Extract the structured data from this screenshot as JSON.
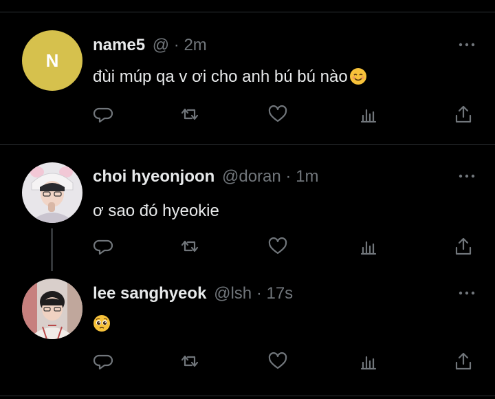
{
  "tweets": [
    {
      "avatar_letter": "N",
      "name": "name5",
      "handle": "@",
      "separator": "·",
      "time": "2m",
      "text": "đùi múp qa v ơi cho anh bú bú nào",
      "text_emoji": "smiling-face-icon"
    },
    {
      "name": "choi hyeonjoon",
      "handle": "@doran",
      "separator": "·",
      "time": "1m",
      "text": "ơ sao đó hyeokie"
    },
    {
      "name": "lee sanghyeok",
      "handle": "@lsh",
      "separator": "·",
      "time": "17s",
      "text": "",
      "text_emoji": "pleading-face-icon"
    }
  ],
  "colors": {
    "background": "#000000",
    "divider": "#2f3336",
    "muted": "#71767b",
    "text": "#e7e9ea",
    "avatar_bg": "#d6c14d"
  },
  "action_icons": [
    "reply-icon",
    "retweet-icon",
    "like-icon",
    "views-icon",
    "share-icon"
  ]
}
